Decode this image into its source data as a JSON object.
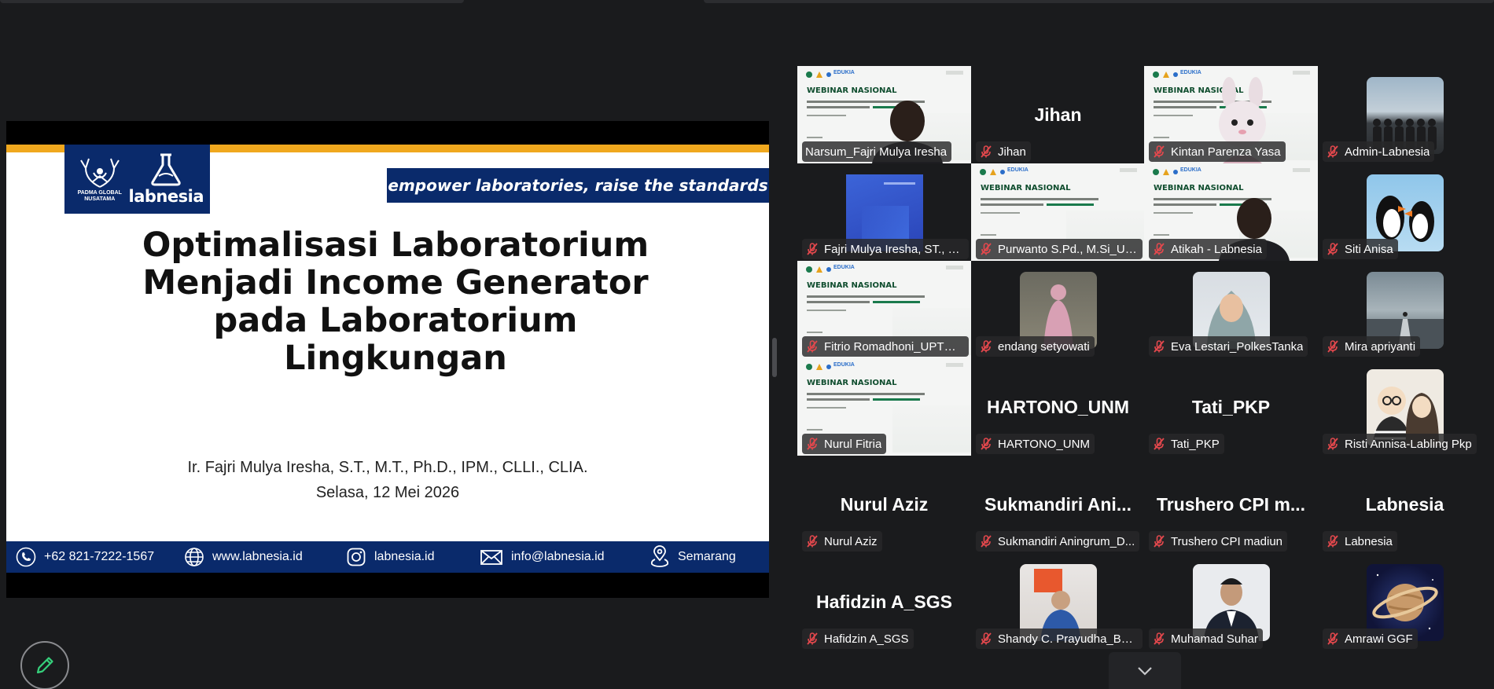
{
  "slide": {
    "logo_padma": "PADMA GLOBAL NUSATAMA",
    "logo_labnesia": "labnesia",
    "tagline": "empower laboratories, raise the standards",
    "title_lines": [
      "Optimalisasi Laboratorium",
      "Menjadi Income Generator",
      "pada Laboratorium",
      "Lingkungan"
    ],
    "author": "Ir. Fajri Mulya Iresha, S.T., M.T., Ph.D., IPM., CLLI., CLIA.",
    "date": "Selasa, 12 Mei 2026",
    "footer": {
      "phone": "+62 821-7222-1567",
      "website": "www.labnesia.id",
      "instagram": "labnesia.id",
      "email": "info@labnesia.id",
      "location": "Semarang"
    }
  },
  "webinar_thumb": {
    "brand": "EDUKIA",
    "title": "WEBINAR NASIONAL"
  },
  "participants": [
    {
      "name": "Narsum_Fajri Mulya Iresha",
      "kind": "webinar-with-person",
      "active": true,
      "muted": false
    },
    {
      "name": "Jihan",
      "kind": "name",
      "big": "Jihan",
      "muted": true
    },
    {
      "name": "Kintan Parenza Yasa",
      "kind": "webinar-with-avatar",
      "muted": true
    },
    {
      "name": "Admin-Labnesia",
      "kind": "photo-group",
      "muted": true
    },
    {
      "name": "Fajri Mulya Iresha, ST., M.T.",
      "kind": "blue-screen",
      "muted": true
    },
    {
      "name": "Purwanto S.Pd., M.Si_UN...",
      "kind": "webinar",
      "muted": true
    },
    {
      "name": "Atikah - Labnesia",
      "kind": "webinar-with-person",
      "muted": true
    },
    {
      "name": "Siti Anisa",
      "kind": "photo-puffin",
      "muted": true
    },
    {
      "name": "Fitrio Romadhoni_UPTD L...",
      "kind": "webinar",
      "muted": true
    },
    {
      "name": "endang setyowati",
      "kind": "photo-pink",
      "muted": true
    },
    {
      "name": "Eva Lestari_PolkesTanka",
      "kind": "photo-hijab",
      "muted": true
    },
    {
      "name": "Mira apriyanti",
      "kind": "photo-pier",
      "muted": true
    },
    {
      "name": "Nurul Fitria",
      "kind": "webinar",
      "muted": true
    },
    {
      "name": "HARTONO_UNM",
      "kind": "name",
      "big": "HARTONO_UNM",
      "muted": true
    },
    {
      "name": "Tati_PKP",
      "kind": "name",
      "big": "Tati_PKP",
      "muted": true
    },
    {
      "name": "Risti Annisa-Labling Pkp",
      "kind": "photo-cartoon",
      "muted": true
    },
    {
      "name": "Nurul Aziz",
      "kind": "name",
      "big": "Nurul Aziz",
      "muted": true
    },
    {
      "name": "Sukmandiri Aningrum_D...",
      "kind": "name",
      "big": "Sukmandiri Ani...",
      "muted": true
    },
    {
      "name": "Trushero CPI madiun",
      "kind": "name",
      "big": "Trushero CPI m...",
      "muted": true
    },
    {
      "name": "Labnesia",
      "kind": "name",
      "big": "Labnesia",
      "muted": true
    },
    {
      "name": "Hafidzin A_SGS",
      "kind": "name",
      "big": "Hafidzin A_SGS",
      "muted": true
    },
    {
      "name": "Shandy C. Prayudha_BPB...",
      "kind": "photo-orange",
      "muted": true
    },
    {
      "name": "Muhamad Suhar",
      "kind": "photo-formal",
      "muted": true
    },
    {
      "name": "Amrawi GGF",
      "kind": "photo-saturn",
      "muted": true
    }
  ]
}
